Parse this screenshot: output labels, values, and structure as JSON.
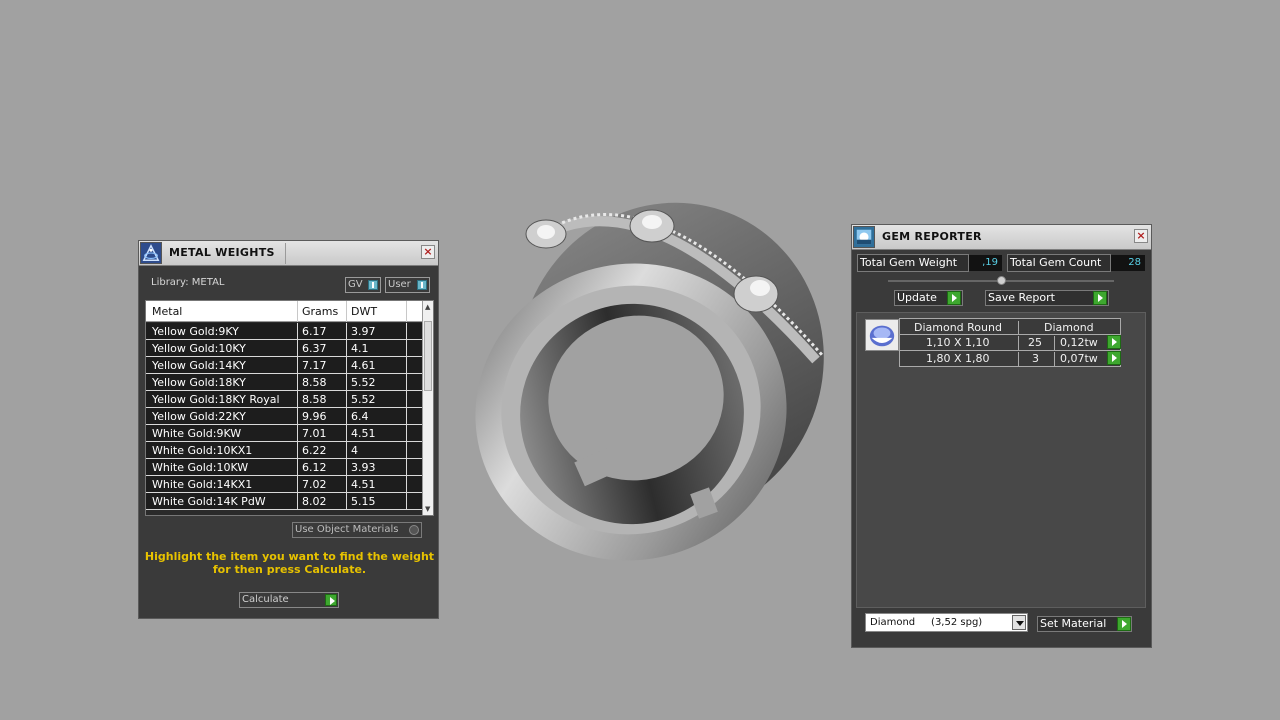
{
  "metal_panel": {
    "title": "METAL WEIGHTS",
    "library_label": "Library: METAL",
    "toggles": [
      "GV",
      "User"
    ],
    "columns": [
      "Metal",
      "Grams",
      "DWT"
    ],
    "rows": [
      {
        "metal": "Yellow Gold:9KY",
        "grams": "6.17",
        "dwt": "3.97"
      },
      {
        "metal": "Yellow Gold:10KY",
        "grams": "6.37",
        "dwt": "4.1"
      },
      {
        "metal": "Yellow Gold:14KY",
        "grams": "7.17",
        "dwt": "4.61"
      },
      {
        "metal": "Yellow Gold:18KY",
        "grams": "8.58",
        "dwt": "5.52"
      },
      {
        "metal": "Yellow Gold:18KY Royal",
        "grams": "8.58",
        "dwt": "5.52"
      },
      {
        "metal": "Yellow Gold:22KY",
        "grams": "9.96",
        "dwt": "6.4"
      },
      {
        "metal": "White Gold:9KW",
        "grams": "7.01",
        "dwt": "4.51"
      },
      {
        "metal": "White Gold:10KX1",
        "grams": "6.22",
        "dwt": "4"
      },
      {
        "metal": "White Gold:10KW",
        "grams": "6.12",
        "dwt": "3.93"
      },
      {
        "metal": "White Gold:14KX1",
        "grams": "7.02",
        "dwt": "4.51"
      },
      {
        "metal": "White Gold:14K PdW",
        "grams": "8.02",
        "dwt": "5.15"
      }
    ],
    "use_object_label": "Use Object Materials",
    "hint_line1": "Highlight the item you want to find the weight",
    "hint_line2": "for then press Calculate.",
    "calculate_label": "Calculate"
  },
  "gem_panel": {
    "title": "GEM REPORTER",
    "total_weight_label": "Total Gem Weight",
    "total_weight_value": ",19",
    "total_count_label": "Total Gem Count",
    "total_count_value": "28",
    "update_label": "Update",
    "save_label": "Save Report",
    "table_header": {
      "shape": "Diamond Round",
      "material": "Diamond"
    },
    "rows": [
      {
        "size": "1,10 X 1,10",
        "count": "25",
        "weight": "0,12tw"
      },
      {
        "size": "1,80 X 1,80",
        "count": "3",
        "weight": "0,07tw"
      }
    ],
    "material_select": "Diamond     (3,52 spg)",
    "set_material_label": "Set Material"
  },
  "colors": {
    "background": "#a1a1a1",
    "panel": "#3a3a3a",
    "accent_green": "#3ea82f",
    "hint_yellow": "#e7c200",
    "value_cyan": "#59d0e6"
  }
}
